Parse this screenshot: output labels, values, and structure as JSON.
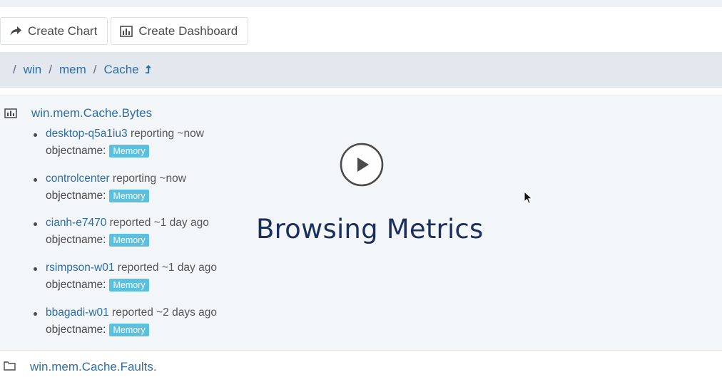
{
  "toolbar": {
    "create_chart": "Create Chart",
    "create_dashboard": "Create Dashboard"
  },
  "breadcrumb": {
    "items": [
      "win",
      "mem",
      "Cache"
    ],
    "separator": "/"
  },
  "metric": {
    "name": "win.mem.Cache.Bytes",
    "hosts": [
      {
        "name": "desktop-q5a1iu3",
        "status": "reporting ~now",
        "object_label": "objectname:",
        "tag": "Memory"
      },
      {
        "name": "controlcenter",
        "status": "reporting ~now",
        "object_label": "objectname:",
        "tag": "Memory"
      },
      {
        "name": "cianh-e7470",
        "status": "reported ~1 day ago",
        "object_label": "objectname:",
        "tag": "Memory"
      },
      {
        "name": "rsimpson-w01",
        "status": "reported ~1 day ago",
        "object_label": "objectname:",
        "tag": "Memory"
      },
      {
        "name": "bbagadi-w01",
        "status": "reported ~2 days ago",
        "object_label": "objectname:",
        "tag": "Memory"
      }
    ]
  },
  "next_item": {
    "name": "win.mem.Cache.Faults."
  },
  "overlay": {
    "title": "Browsing Metrics"
  },
  "colors": {
    "link": "#2e6da4",
    "tag": "#5bc0de",
    "breadcrumb_bg": "#e3e8ee",
    "panel_bg": "#f3f6f9",
    "overlay_text": "#1b2f5c"
  }
}
